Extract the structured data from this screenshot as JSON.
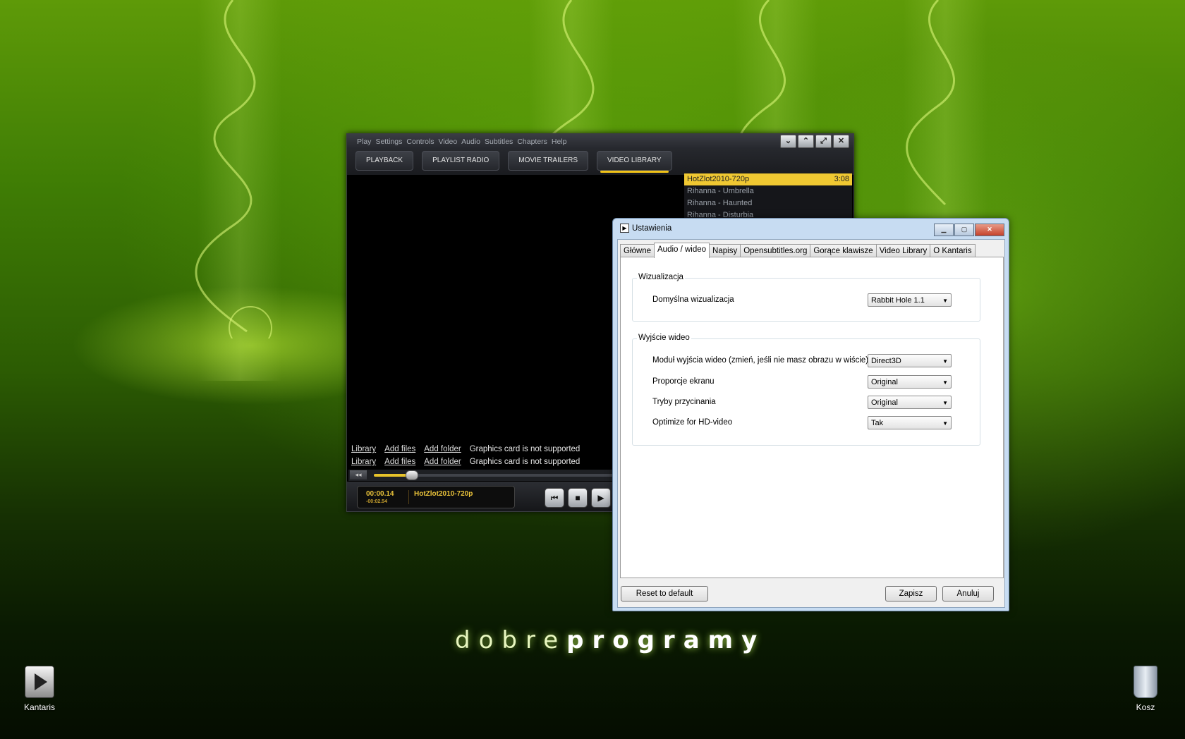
{
  "desktop": {
    "brand_light": "dobre",
    "brand_bold": "programy",
    "icons": [
      {
        "label": "Kantaris",
        "icon": "media-player-icon"
      },
      {
        "label": "Kosz",
        "icon": "recycle-bin-icon"
      }
    ]
  },
  "player": {
    "menu": [
      "Play",
      "Settings",
      "Controls",
      "Video",
      "Audio",
      "Subtitles",
      "Chapters",
      "Help"
    ],
    "tabs": [
      "PLAYBACK",
      "PLAYLIST RADIO",
      "MOVIE TRAILERS",
      "VIDEO LIBRARY"
    ],
    "active_tab": "VIDEO LIBRARY",
    "playlist": [
      {
        "title": "HotZlot2010-720p",
        "duration": "3:08",
        "selected": true
      },
      {
        "title": "Rihanna - Umbrella",
        "duration": ""
      },
      {
        "title": "Rihanna - Haunted",
        "duration": ""
      },
      {
        "title": "Rihanna - Disturbia",
        "duration": ""
      }
    ],
    "library_rows": [
      {
        "library": "Library",
        "add_files": "Add files",
        "add_folder": "Add folder",
        "status": "Graphics card is not supported"
      },
      {
        "library": "Library",
        "add_files": "Add files",
        "add_folder": "Add folder",
        "status": "Graphics card is not supported"
      }
    ],
    "seek_back": "◂◂",
    "progress": 0.078,
    "time_elapsed": "00:00.14",
    "time_remaining": "-00:02.54",
    "now_playing": "HotZlot2010-720p",
    "accent_color": "#f2c418"
  },
  "dialog": {
    "title": "Ustawienia",
    "tabs": [
      "Główne",
      "Audio / wideo",
      "Napisy",
      "Opensubtitles.org",
      "Gorące klawisze",
      "Video Library",
      "O Kantaris"
    ],
    "active_tab": "Audio / wideo",
    "groups": {
      "visualization": {
        "label": "Wizualizacja",
        "rows": [
          {
            "label": "Domyślna wizualizacja",
            "value": "Rabbit Hole 1.1"
          }
        ]
      },
      "video_output": {
        "label": "Wyjście wideo",
        "rows": [
          {
            "label": "Moduł wyjścia wideo (zmień, jeśli nie masz obrazu w wiście)",
            "value": "Direct3D"
          },
          {
            "label": "Proporcje ekranu",
            "value": "Original"
          },
          {
            "label": "Tryby przycinania",
            "value": "Original"
          },
          {
            "label": "Optimize for HD-video",
            "value": "Tak"
          }
        ]
      }
    },
    "buttons": {
      "reset": "Reset to default",
      "save": "Zapisz",
      "cancel": "Anuluj"
    }
  }
}
